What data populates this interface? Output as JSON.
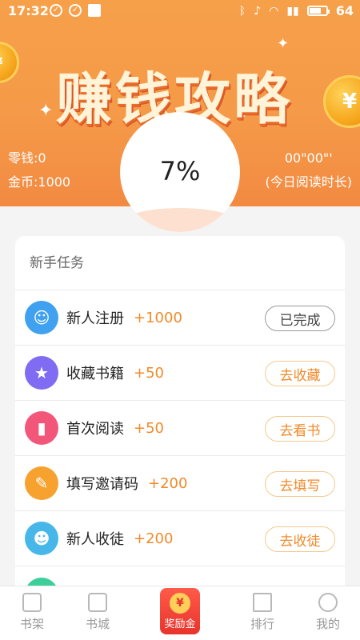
{
  "status_bar": {
    "time": "17:32",
    "battery": "64"
  },
  "hero": {
    "title": "赚钱攻略",
    "change_label": "零钱:0",
    "coins_label": "金币:1000",
    "read_time": "00\"00\"'",
    "read_time_label": "(今日阅读时长)",
    "progress_text": "7%",
    "progress": 0.07
  },
  "card": {
    "title": "新手任务",
    "tasks": [
      {
        "name": "新人注册",
        "points": "+1000",
        "button": "已完成",
        "done": true,
        "color": "#3fa1f0"
      },
      {
        "name": "收藏书籍",
        "points": "+50",
        "button": "去收藏",
        "done": false,
        "color": "#7f6cf2"
      },
      {
        "name": "首次阅读",
        "points": "+50",
        "button": "去看书",
        "done": false,
        "color": "#f2577a"
      },
      {
        "name": "填写邀请码",
        "points": "+200",
        "button": "去填写",
        "done": false,
        "color": "#f7a12f"
      },
      {
        "name": "新人收徒",
        "points": "+200",
        "button": "去收徒",
        "done": false,
        "color": "#46b7e8"
      }
    ]
  },
  "tabbar": {
    "bookshelf": "书架",
    "bookstore": "书城",
    "reward": "奖励金",
    "reward_icon": "¥",
    "ranking": "排行",
    "mine": "我的"
  }
}
